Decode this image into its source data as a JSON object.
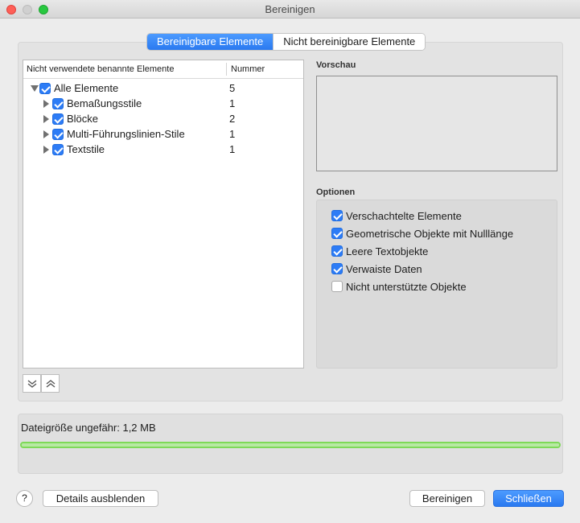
{
  "window": {
    "title": "Bereinigen"
  },
  "tabs": [
    {
      "label": "Bereinigbare Elemente",
      "active": true
    },
    {
      "label": "Nicht bereinigbare Elemente",
      "active": false
    }
  ],
  "tree": {
    "columns": {
      "name": "Nicht verwendete benannte Elemente",
      "count": "Nummer"
    },
    "rows": [
      {
        "label": "Alle Elemente",
        "count": "5",
        "checked": true,
        "expanded": true
      },
      {
        "label": "Bemaßungsstile",
        "count": "1",
        "checked": true,
        "expanded": false
      },
      {
        "label": "Blöcke",
        "count": "2",
        "checked": true,
        "expanded": false
      },
      {
        "label": "Multi-Führungslinien-Stile",
        "count": "1",
        "checked": true,
        "expanded": false
      },
      {
        "label": "Textstile",
        "count": "1",
        "checked": true,
        "expanded": false
      }
    ]
  },
  "preview": {
    "label": "Vorschau"
  },
  "options": {
    "label": "Optionen",
    "items": [
      {
        "label": "Verschachtelte Elemente",
        "checked": true
      },
      {
        "label": "Geometrische Objekte mit Nulllänge",
        "checked": true
      },
      {
        "label": "Leere Textobjekte",
        "checked": true
      },
      {
        "label": "Verwaiste Daten",
        "checked": true
      },
      {
        "label": "Nicht unterstützte Objekte",
        "checked": false
      }
    ]
  },
  "status": {
    "text": "Dateigröße ungefähr: 1,2 MB",
    "progress": 1.0,
    "progress_color": "#7ed957"
  },
  "footer": {
    "help_label": "?",
    "details_label": "Details ausblenden",
    "purge_label": "Bereinigen",
    "close_label": "Schließen"
  },
  "colors": {
    "accent": "#2a79f0"
  }
}
